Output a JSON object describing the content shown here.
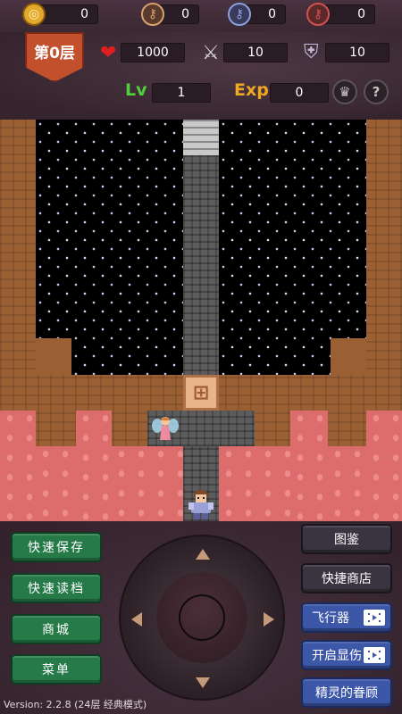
{
  "resources": [
    {
      "name": "gold",
      "icon": "coin-icon",
      "value": "0",
      "color": "#e3a92a"
    },
    {
      "name": "yellow-key",
      "icon": "yellow-key-icon",
      "value": "0",
      "color": "#d8a070"
    },
    {
      "name": "blue-key",
      "icon": "blue-key-icon",
      "value": "0",
      "color": "#8aa0e0"
    },
    {
      "name": "red-key",
      "icon": "red-key-icon",
      "value": "0",
      "color": "#d65050"
    }
  ],
  "floor": {
    "label": "第0层"
  },
  "stats": {
    "hp": "1000",
    "attack": "10",
    "defense": "10",
    "lv_label": "Lv",
    "lv": "1",
    "exp_label": "Exp",
    "exp": "0"
  },
  "left_buttons": [
    "快速保存",
    "快速读档",
    "商城",
    "菜单"
  ],
  "right_buttons": [
    "图鉴",
    "快捷商店",
    "飞行器",
    "开启显伤",
    "精灵的眷顾"
  ],
  "version": "Version: 2.2.8 (24层 经典模式)",
  "colors": {
    "green_button": "#257a47",
    "dark_button": "#3a3440",
    "blue_button": "#3c56a8",
    "floor_badge": "#c2502d",
    "lava": "#dd6d6d",
    "brick": "#9a5f33"
  }
}
